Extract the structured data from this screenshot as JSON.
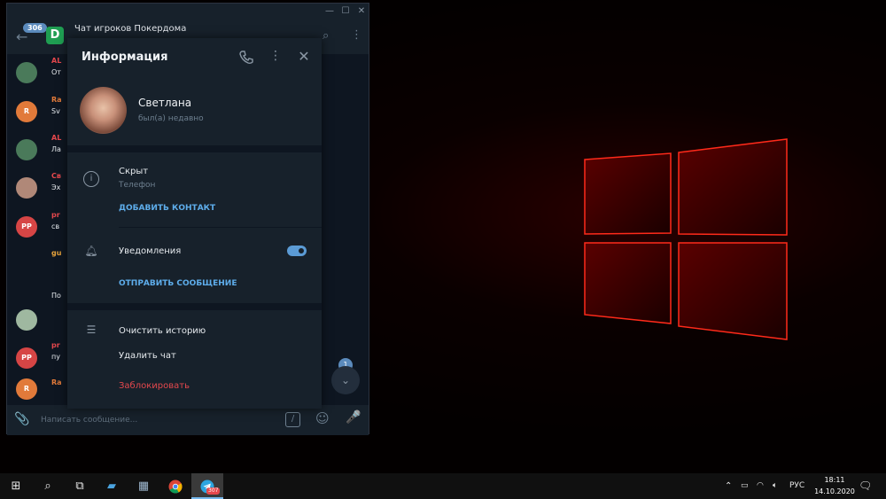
{
  "window": {
    "minimize_icon": "minimize-icon",
    "maximize_icon": "maximize-icon",
    "close_icon": "close-icon"
  },
  "chat_header": {
    "unread_count": "306",
    "title": "Чат игроков Покердома"
  },
  "chat_messages": [
    {
      "sender": "AL",
      "text": "От",
      "avatar": "photo",
      "name_color": "#e5484d"
    },
    {
      "sender": "Ra",
      "text": "Sv",
      "avatar_initial": "R",
      "avatar_color": "#e17a3a",
      "name_color": "#e17a3a"
    },
    {
      "sender": "AL",
      "text": "Ла",
      "avatar": "photo",
      "name_color": "#e5484d"
    },
    {
      "sender": "Св",
      "text": "Эх",
      "avatar": "photo",
      "name_color": "#e5484d"
    },
    {
      "sender": "pr",
      "text": "св",
      "avatar_initial": "PP",
      "avatar_color": "#d64545",
      "name_color": "#e5484d"
    },
    {
      "sender": "gu",
      "text": "По",
      "name_color": "#e6a23c"
    },
    {
      "sender": "pr",
      "text": "пу",
      "avatar_initial": "PP",
      "avatar_color": "#d64545",
      "name_color": "#e5484d"
    },
    {
      "sender": "Ra",
      "text": "",
      "avatar_initial": "R",
      "avatar_color": "#e17a3a",
      "name_color": "#e17a3a"
    }
  ],
  "scroll_badge": "1",
  "composer": {
    "placeholder": "Написать сообщение..."
  },
  "info_panel": {
    "title": "Информация",
    "profile_name": "Светлана",
    "profile_status": "был(а) недавно",
    "phone_label": "Скрыт",
    "phone_sub": "Телефон",
    "add_contact": "ДОБАВИТЬ КОНТАКТ",
    "notifications_label": "Уведомления",
    "notifications_on": true,
    "send_message": "ОТПРАВИТЬ СООБЩЕНИЕ",
    "clear_history": "Очистить историю",
    "delete_chat": "Удалить чат",
    "block": "Заблокировать"
  },
  "taskbar": {
    "telegram_badge": "307",
    "language": "РУС",
    "time": "18:11",
    "date": "14.10.2020"
  },
  "colors": {
    "panel_bg": "#17212b",
    "chat_bg": "#0e1621",
    "accent_link": "#5eadeb",
    "danger": "#e5484d"
  }
}
